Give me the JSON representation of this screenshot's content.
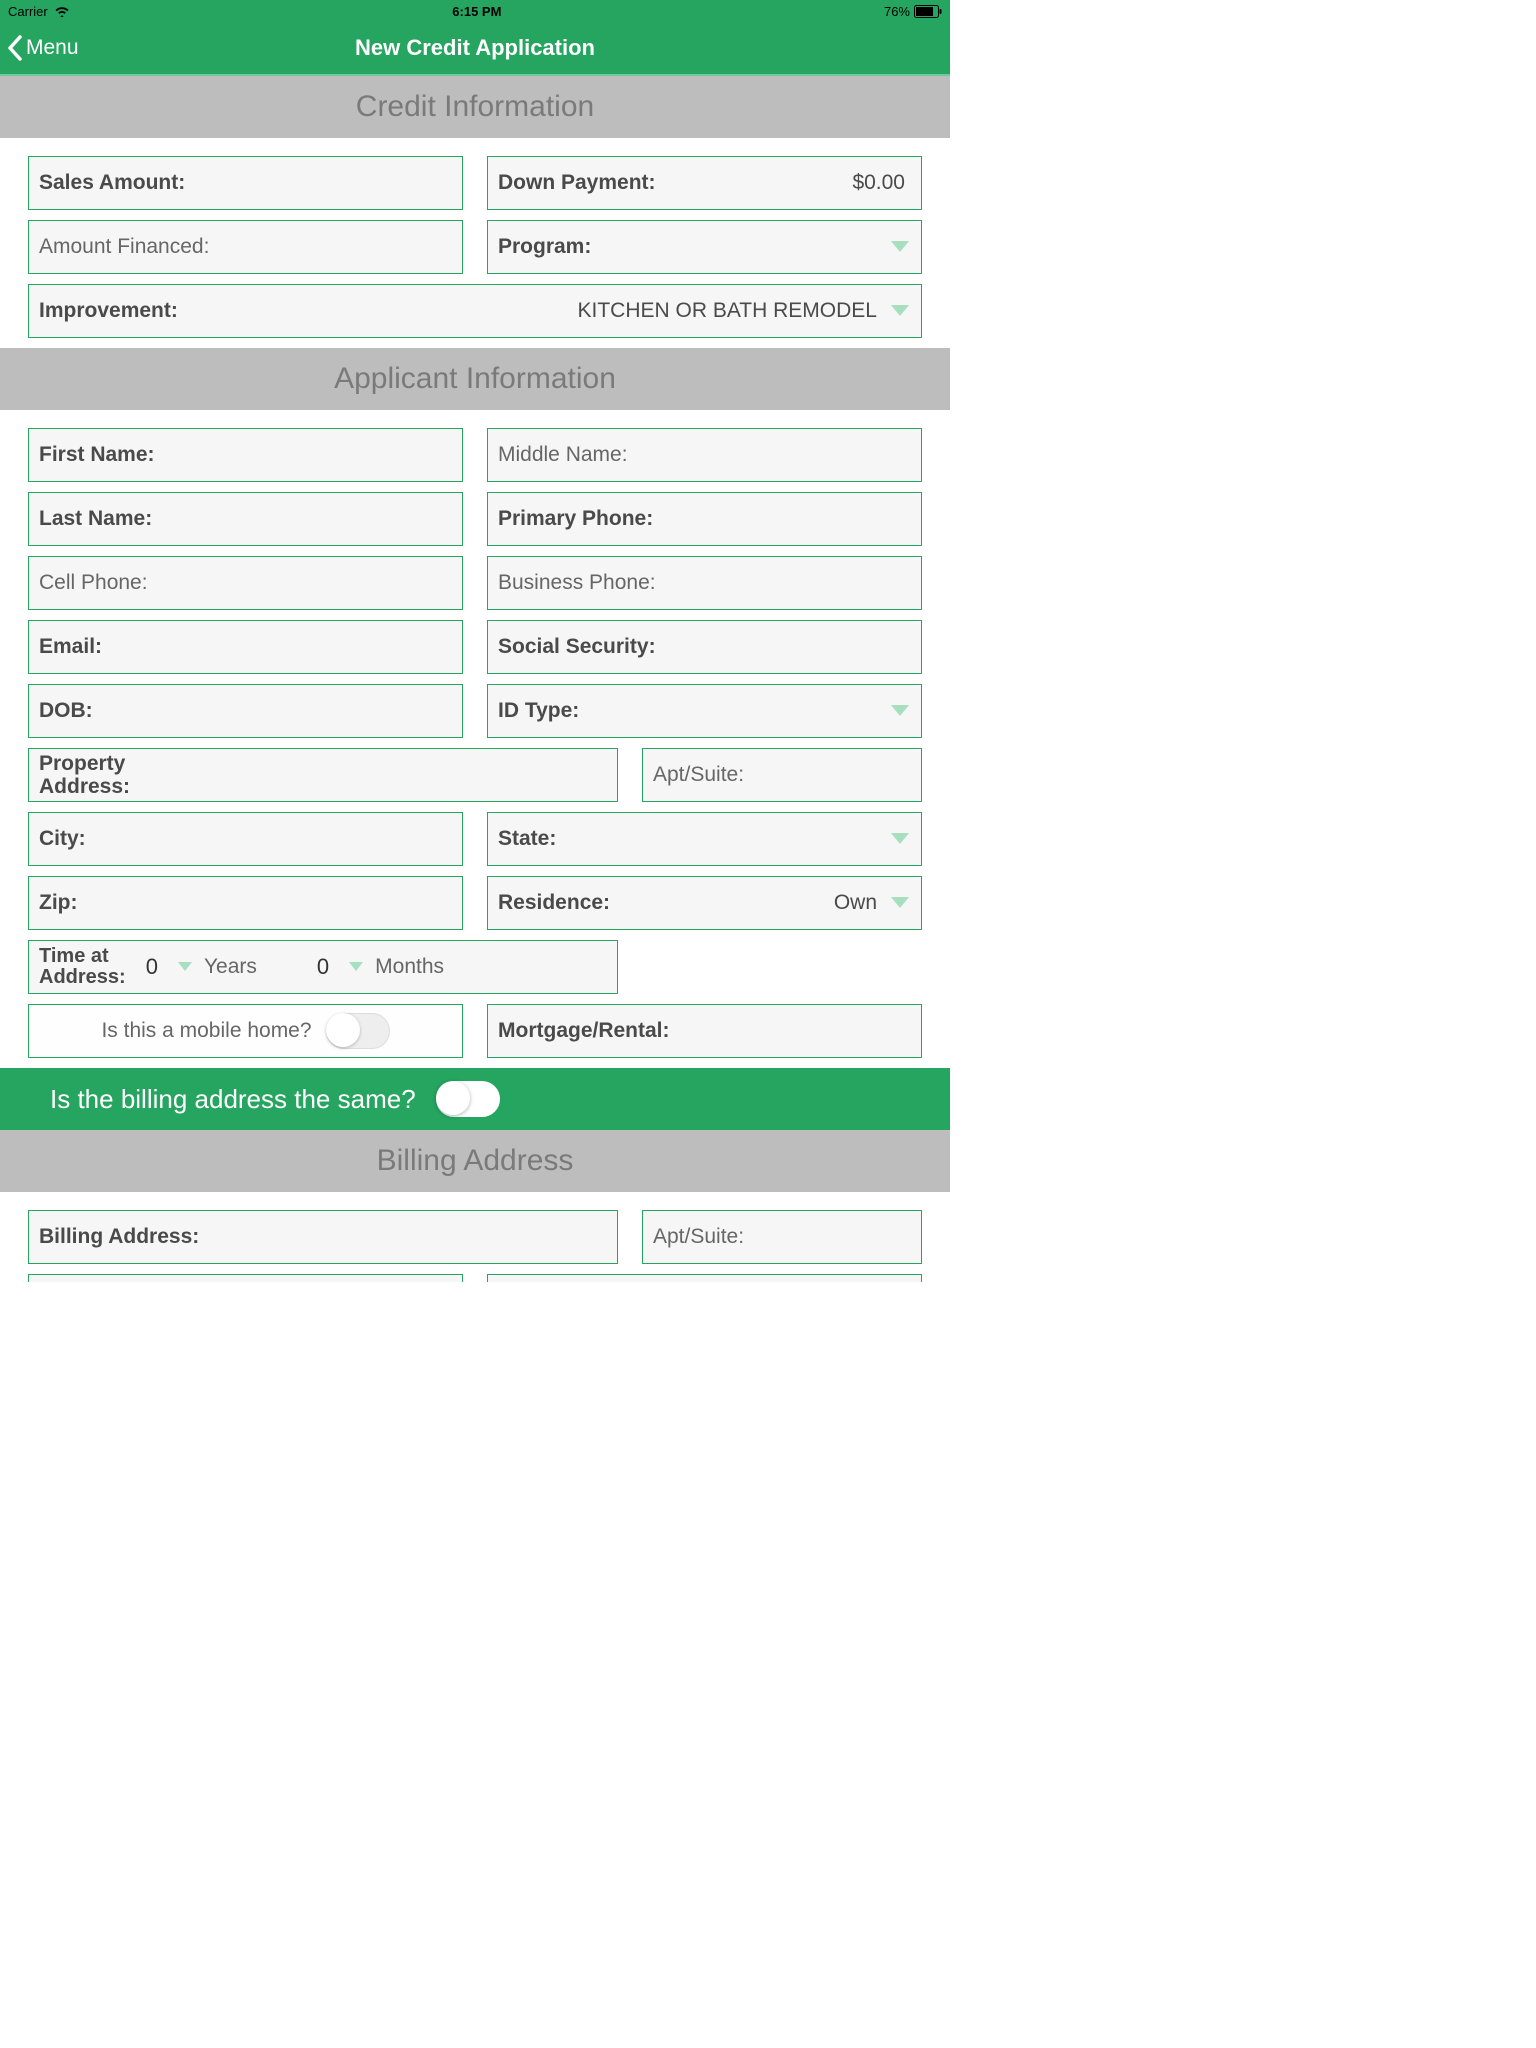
{
  "status": {
    "carrier": "Carrier",
    "time": "6:15 PM",
    "battery_pct": "76%"
  },
  "nav": {
    "back": "Menu",
    "title": "New Credit Application"
  },
  "sections": {
    "credit": "Credit Information",
    "applicant": "Applicant Information",
    "billing": "Billing Address"
  },
  "credit": {
    "sales_amount": "Sales Amount:",
    "down_payment": "Down Payment:",
    "down_payment_val": "$0.00",
    "amount_financed": "Amount Financed:",
    "program": "Program:",
    "improvement": "Improvement:",
    "improvement_val": "KITCHEN OR BATH REMODEL"
  },
  "applicant": {
    "first_name": "First Name:",
    "middle_name": "Middle Name:",
    "last_name": "Last Name:",
    "primary_phone": "Primary Phone:",
    "cell_phone": "Cell Phone:",
    "business_phone": "Business Phone:",
    "email": "Email:",
    "ssn": "Social Security:",
    "dob": "DOB:",
    "id_type": "ID Type:",
    "property_address": "Property\nAddress:",
    "apt_suite": "Apt/Suite:",
    "city": "City:",
    "state": "State:",
    "zip": "Zip:",
    "residence": "Residence:",
    "residence_val": "Own",
    "time_at_address": "Time at\nAddress:",
    "time_years_val": "0",
    "time_years_unit": "Years",
    "time_months_val": "0",
    "time_months_unit": "Months",
    "mobile_home_q": "Is this a mobile home?",
    "mortgage_rental": "Mortgage/Rental:"
  },
  "billing_q": "Is the billing address the same?",
  "billing": {
    "billing_address": "Billing Address:",
    "apt_suite": "Apt/Suite:"
  }
}
